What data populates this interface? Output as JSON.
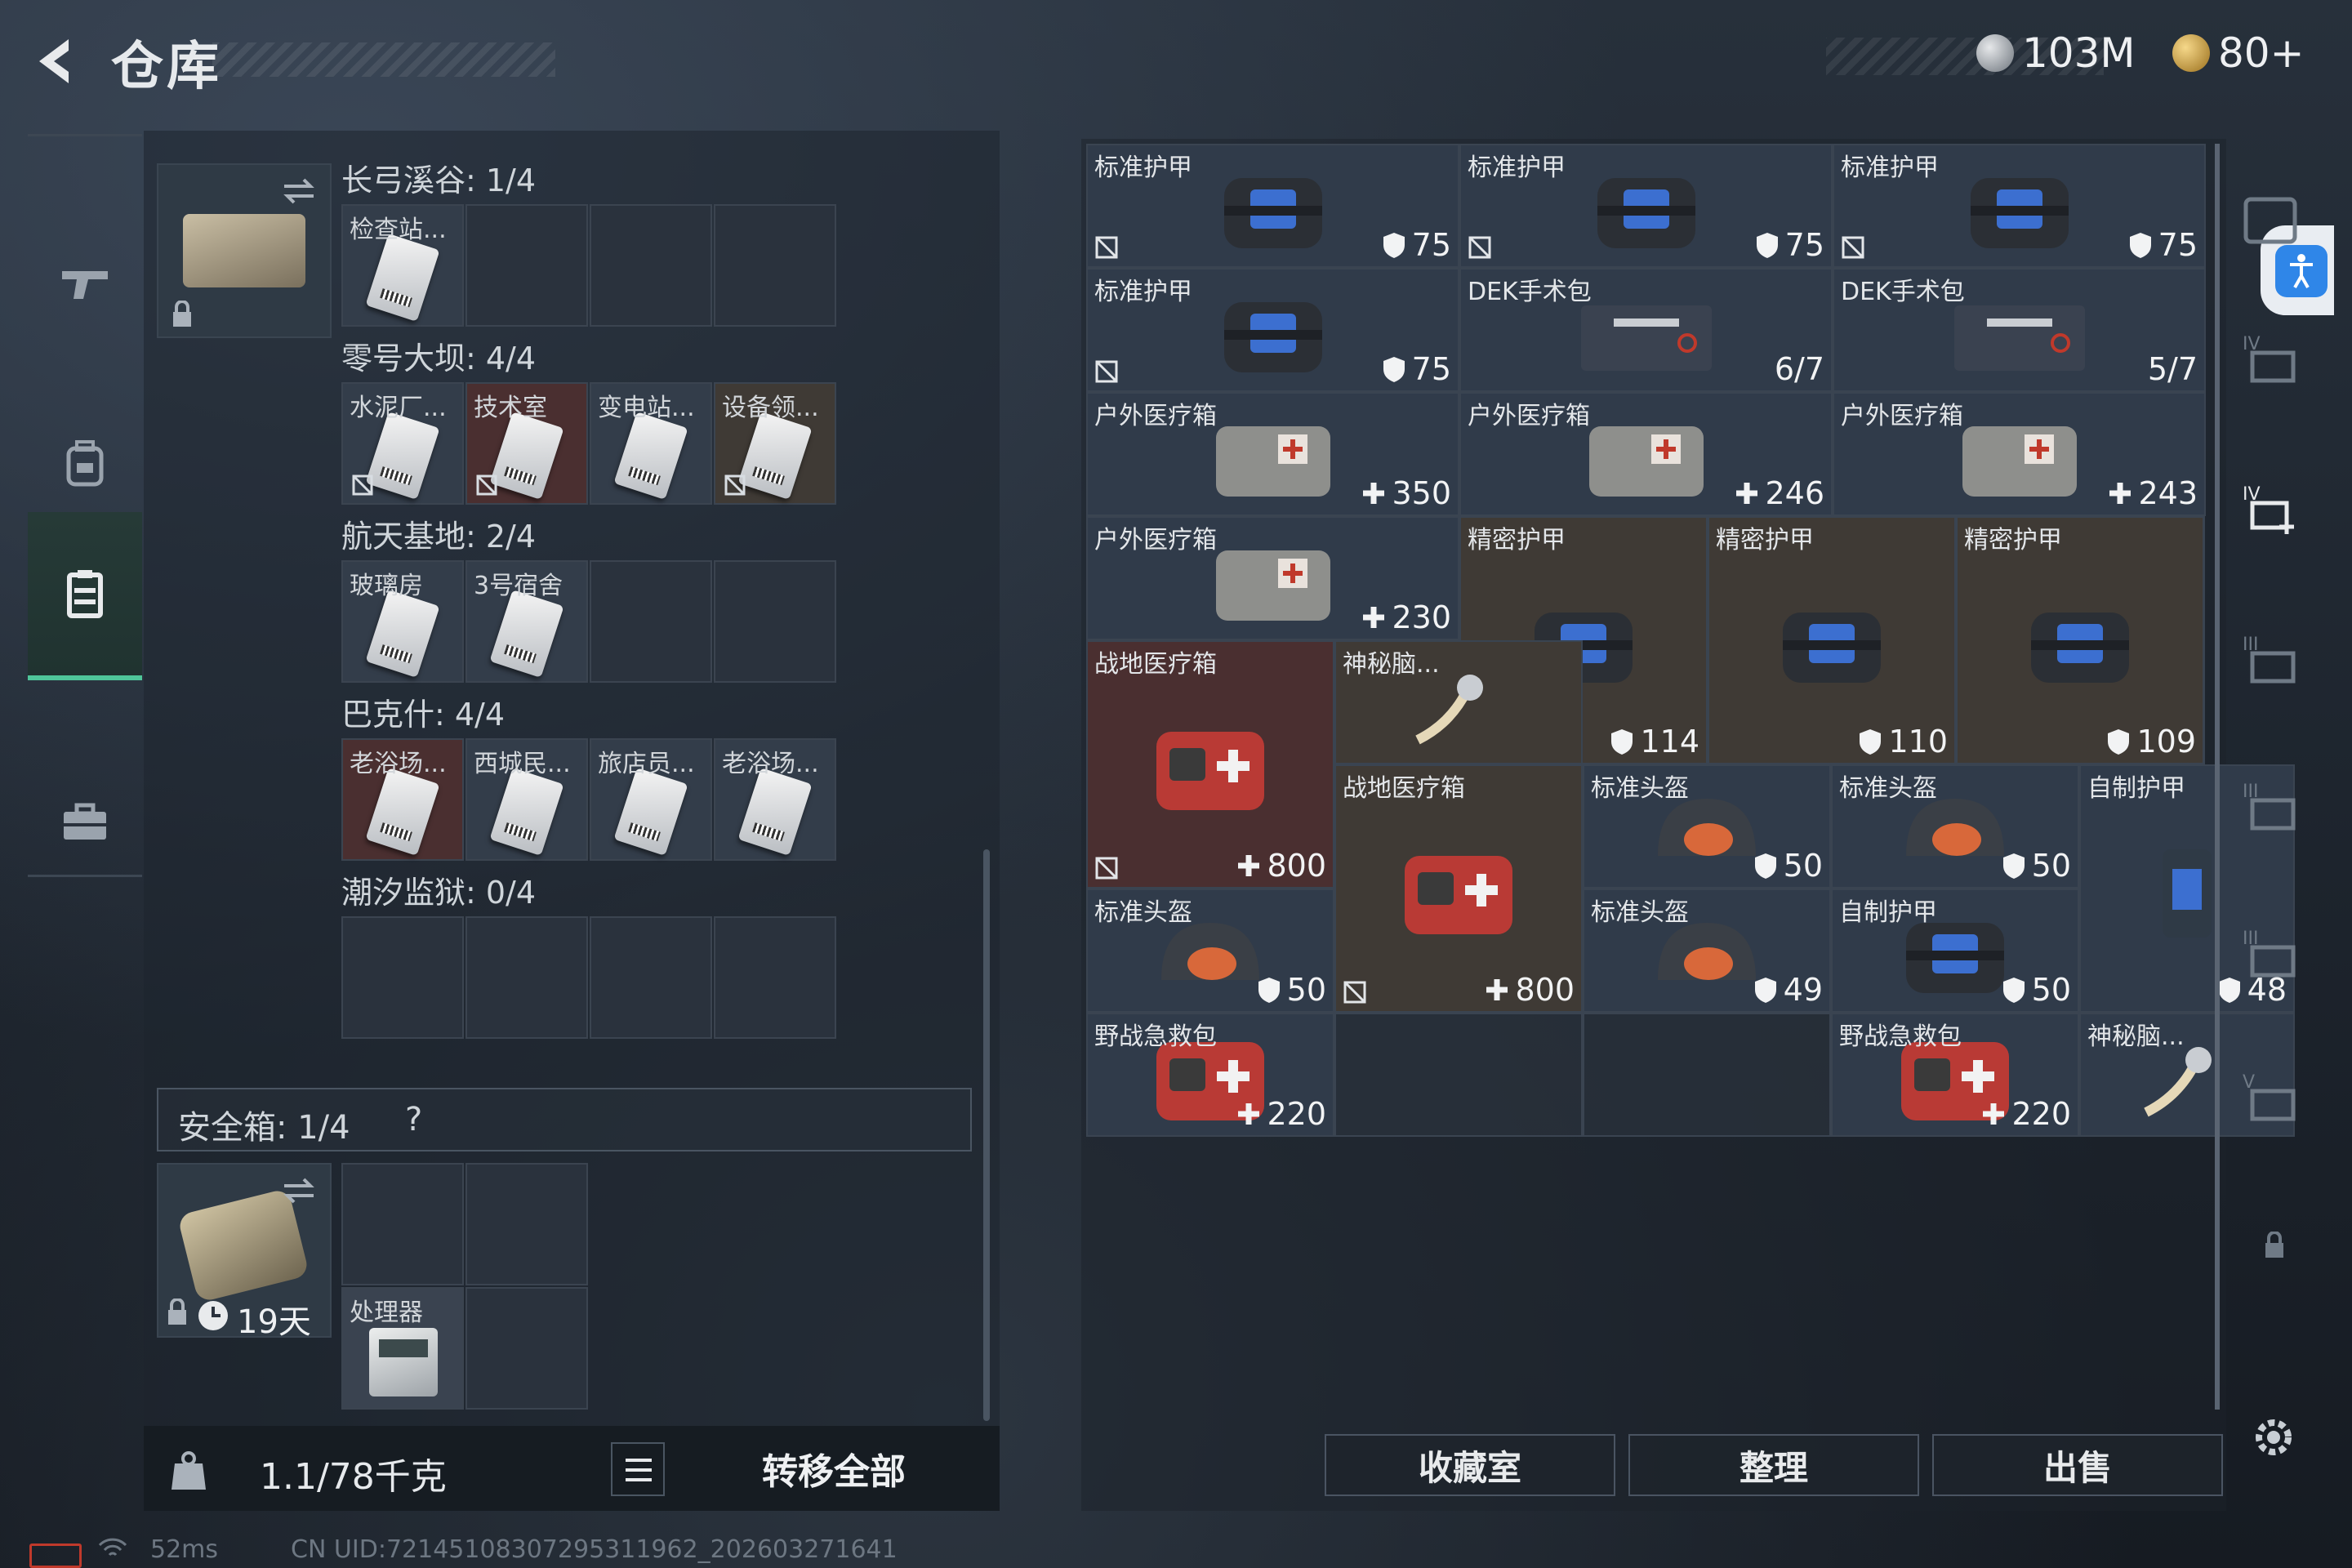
{
  "header": {
    "title": "仓库",
    "currency1": "103M",
    "currency2": "80+"
  },
  "nav": {
    "items": [
      "weapons",
      "backpack",
      "storage",
      "case"
    ]
  },
  "left": {
    "sections": [
      {
        "title": "长弓溪谷: 1/4",
        "slots": [
          {
            "label": "检查站...",
            "kind": "biohazard"
          },
          {
            "label": ""
          },
          {
            "label": ""
          },
          {
            "label": ""
          }
        ]
      },
      {
        "title": "零号大坝: 4/4",
        "slots": [
          {
            "label": "水泥厂...",
            "nodrop": true
          },
          {
            "label": "技术室",
            "nodrop": true,
            "red": true
          },
          {
            "label": "变电站..."
          },
          {
            "label": "设备领...",
            "nodrop": true,
            "brown": true
          }
        ]
      },
      {
        "title": "航天基地: 2/4",
        "slots": [
          {
            "label": "玻璃房"
          },
          {
            "label": "3号宿舍"
          },
          {
            "label": ""
          },
          {
            "label": ""
          }
        ]
      },
      {
        "title": "巴克什: 4/4",
        "slots": [
          {
            "label": "老浴场...",
            "red": true
          },
          {
            "label": "西城民..."
          },
          {
            "label": "旅店员..."
          },
          {
            "label": "老浴场..."
          }
        ]
      },
      {
        "title": "潮汐监狱: 0/4",
        "slots": [
          {
            "label": ""
          },
          {
            "label": ""
          },
          {
            "label": ""
          },
          {
            "label": ""
          }
        ]
      }
    ],
    "safe_box": {
      "title": "安全箱: 1/4",
      "help": "?",
      "timer": "19天",
      "item_label": "处理器"
    },
    "weight": "1.1/78千克",
    "transfer_all": "转移全部"
  },
  "items": [
    {
      "name": "标准护甲",
      "value": "75",
      "icon": "armor",
      "kind": "shield",
      "nodrop": true
    },
    {
      "name": "标准护甲",
      "value": "75",
      "icon": "armor",
      "kind": "shield",
      "nodrop": true
    },
    {
      "name": "标准护甲",
      "value": "75",
      "icon": "armor",
      "kind": "shield",
      "nodrop": true
    },
    {
      "name": "标准护甲",
      "value": "75",
      "icon": "armor",
      "kind": "shield",
      "nodrop": true
    },
    {
      "name": "DEK手术包",
      "value": "6/7",
      "icon": "kit"
    },
    {
      "name": "DEK手术包",
      "value": "5/7",
      "icon": "kit"
    },
    {
      "name": "户外医疗箱",
      "value": "350",
      "icon": "medbag",
      "kind": "plus"
    },
    {
      "name": "户外医疗箱",
      "value": "246",
      "icon": "medbag",
      "kind": "plus"
    },
    {
      "name": "户外医疗箱",
      "value": "243",
      "icon": "medbag",
      "kind": "plus"
    },
    {
      "name": "户外医疗箱",
      "value": "230",
      "icon": "medbag",
      "kind": "plus"
    },
    {
      "name": "精密护甲",
      "value": "114",
      "icon": "armor",
      "kind": "shield"
    },
    {
      "name": "精密护甲",
      "value": "110",
      "icon": "armor",
      "kind": "shield"
    },
    {
      "name": "精密护甲",
      "value": "109",
      "icon": "armor",
      "kind": "shield"
    },
    {
      "name": "战地医疗箱",
      "value": "800",
      "icon": "firstaid",
      "kind": "plus",
      "nodrop": true
    },
    {
      "name": "神秘脑...",
      "value": "",
      "icon": "brain"
    },
    {
      "name": "战地医疗箱",
      "value": "800",
      "icon": "firstaid",
      "kind": "plus",
      "nodrop": true
    },
    {
      "name": "标准头盔",
      "value": "50",
      "icon": "helmet",
      "kind": "shield"
    },
    {
      "name": "标准头盔",
      "value": "50",
      "icon": "helmet",
      "kind": "shield"
    },
    {
      "name": "自制护甲",
      "value": "48",
      "icon": "vest",
      "kind": "shield"
    },
    {
      "name": "标准头盔",
      "value": "50",
      "icon": "helmet",
      "kind": "shield"
    },
    {
      "name": "标准头盔",
      "value": "49",
      "icon": "helmet",
      "kind": "shield"
    },
    {
      "name": "自制护甲",
      "value": "50",
      "icon": "armor",
      "kind": "shield"
    },
    {
      "name": "野战急救包",
      "value": "220",
      "icon": "firstaid",
      "kind": "plus"
    },
    {
      "name": "野战急救包",
      "value": "220",
      "icon": "firstaid",
      "kind": "plus"
    },
    {
      "name": "神秘脑...",
      "value": "",
      "icon": "brain"
    }
  ],
  "buttons": {
    "collection": "收藏室",
    "sort": "整理",
    "sell": "出售"
  },
  "status": {
    "ping": "52ms",
    "uid": "CN UID:7214510830729531196­2_202603271641"
  },
  "colors": {
    "accent": "#4fc69a",
    "panel": "#303b4a",
    "brown_cell": "#3f3a35",
    "red_cell": "#4a2f30"
  }
}
